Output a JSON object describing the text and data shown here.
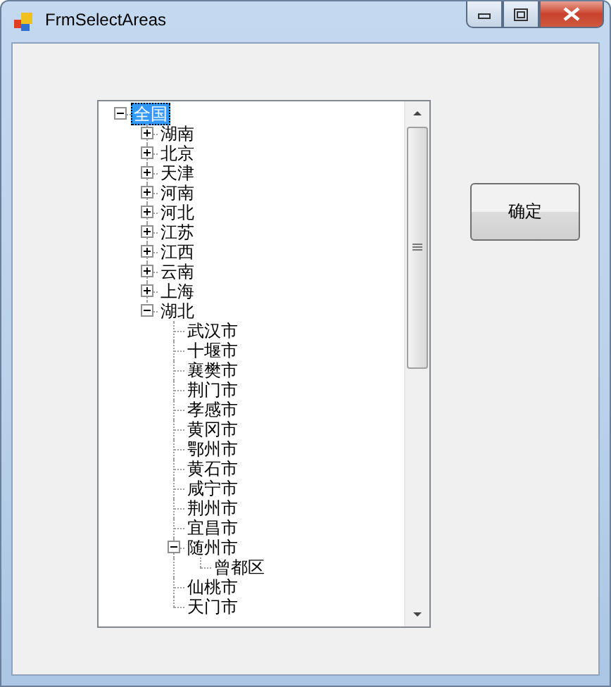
{
  "window": {
    "title": "FrmSelectAreas"
  },
  "tree": [
    {
      "label": "全国",
      "selected": true,
      "expanded": true,
      "children": [
        {
          "label": "湖南",
          "selected": false,
          "expanded": false
        },
        {
          "label": "北京",
          "selected": false,
          "expanded": false
        },
        {
          "label": "天津",
          "selected": false,
          "expanded": false
        },
        {
          "label": "河南",
          "selected": false,
          "expanded": false
        },
        {
          "label": "河北",
          "selected": false,
          "expanded": false
        },
        {
          "label": "江苏",
          "selected": false,
          "expanded": false
        },
        {
          "label": "江西",
          "selected": false,
          "expanded": false
        },
        {
          "label": "云南",
          "selected": false,
          "expanded": false
        },
        {
          "label": "上海",
          "selected": false,
          "expanded": false
        },
        {
          "label": "湖北",
          "selected": false,
          "expanded": true,
          "children": [
            {
              "label": "武汉市",
              "selected": false
            },
            {
              "label": "十堰市",
              "selected": false
            },
            {
              "label": "襄樊市",
              "selected": false
            },
            {
              "label": "荆门市",
              "selected": false
            },
            {
              "label": "孝感市",
              "selected": false
            },
            {
              "label": "黄冈市",
              "selected": false
            },
            {
              "label": "鄂州市",
              "selected": false
            },
            {
              "label": "黄石市",
              "selected": false
            },
            {
              "label": "咸宁市",
              "selected": false
            },
            {
              "label": "荆州市",
              "selected": false
            },
            {
              "label": "宜昌市",
              "selected": false
            },
            {
              "label": "随州市",
              "selected": false,
              "expanded": true,
              "children": [
                {
                  "label": "曾都区",
                  "selected": false
                }
              ]
            },
            {
              "label": "仙桃市",
              "selected": false
            },
            {
              "label": "天门市",
              "selected": false
            }
          ]
        }
      ]
    }
  ],
  "ok_button": "确定"
}
